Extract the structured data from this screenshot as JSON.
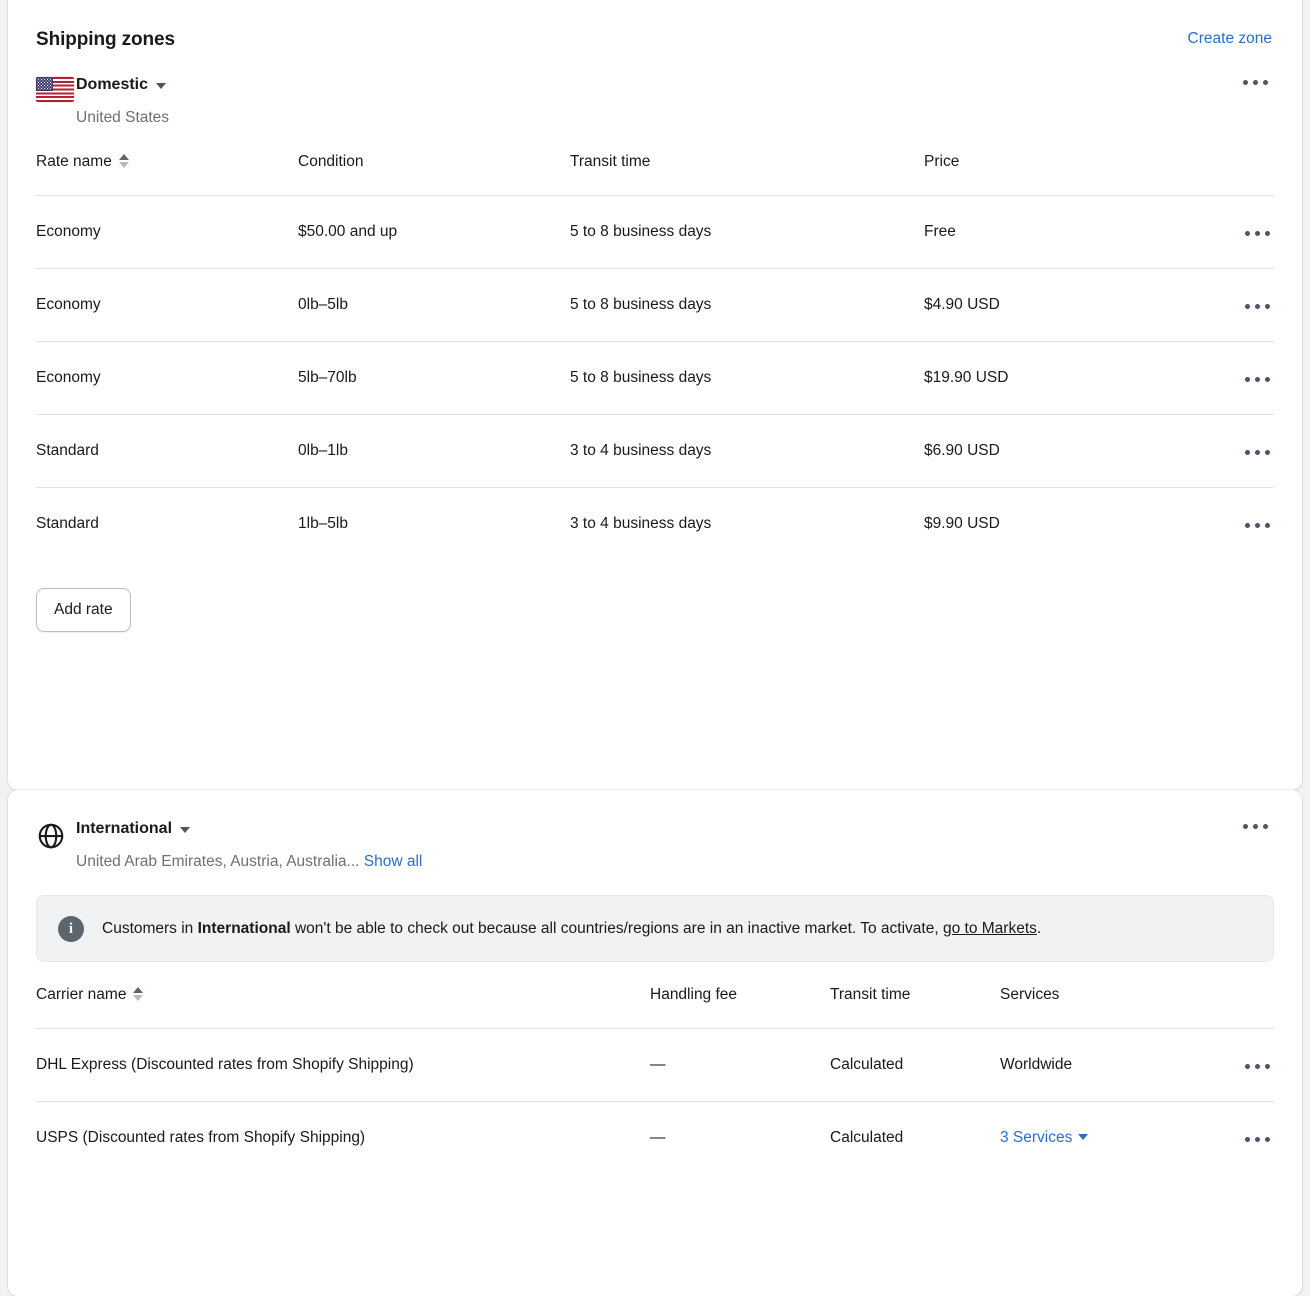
{
  "header": {
    "title": "Shipping zones",
    "create_zone_label": "Create zone"
  },
  "colors": {
    "link": "#2c6ecb",
    "text": "#1a1a1a",
    "muted": "#6b7177",
    "border": "#e3e3e3",
    "banner_bg": "#f1f2f4",
    "info_icon_bg": "#5c6670"
  },
  "zones": [
    {
      "icon": "us-flag-icon",
      "name": "Domestic",
      "subtitle": "United States",
      "menu_icon": "ellipsis-icon",
      "table": {
        "columns": [
          "Rate name",
          "Condition",
          "Transit time",
          "Price"
        ],
        "sortable_column": "Rate name",
        "rows": [
          {
            "rate_name": "Economy",
            "condition": "$50.00 and up",
            "transit_time": "5 to 8 business days",
            "price": "Free"
          },
          {
            "rate_name": "Economy",
            "condition": "0lb–5lb",
            "transit_time": "5 to 8 business days",
            "price": "$4.90 USD"
          },
          {
            "rate_name": "Economy",
            "condition": "5lb–70lb",
            "transit_time": "5 to 8 business days",
            "price": "$19.90 USD"
          },
          {
            "rate_name": "Standard",
            "condition": "0lb–1lb",
            "transit_time": "3 to 4 business days",
            "price": "$6.90 USD"
          },
          {
            "rate_name": "Standard",
            "condition": "1lb–5lb",
            "transit_time": "3 to 4 business days",
            "price": "$9.90 USD"
          }
        ]
      },
      "add_rate_label": "Add rate"
    },
    {
      "icon": "globe-icon",
      "name": "International",
      "subtitle": "United Arab Emirates, Austria, Australia...",
      "show_all_label": "Show all",
      "menu_icon": "ellipsis-icon",
      "banner": {
        "icon": "info-icon",
        "text_part_1": "Customers in ",
        "text_bold": "International",
        "text_part_2": " won't be able to check out because all countries/regions are in an inactive market. To activate, ",
        "text_link": "go to Markets",
        "text_part_3": "."
      },
      "table": {
        "columns": [
          "Carrier name",
          "Handling fee",
          "Transit time",
          "Services"
        ],
        "sortable_column": "Carrier name",
        "rows": [
          {
            "carrier_name": "DHL Express (Discounted rates from Shopify Shipping)",
            "handling_fee": "—",
            "transit_time": "Calculated",
            "services": "Worldwide",
            "services_is_link": false
          },
          {
            "carrier_name": "USPS (Discounted rates from Shopify Shipping)",
            "handling_fee": "—",
            "transit_time": "Calculated",
            "services": "3 Services",
            "services_is_link": true
          }
        ]
      }
    }
  ]
}
